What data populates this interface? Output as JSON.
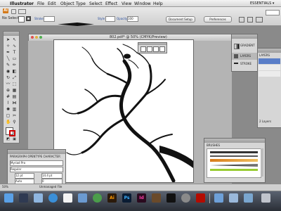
{
  "menubar": {
    "app_name": "Illustrator",
    "items": [
      "File",
      "Edit",
      "Object",
      "Type",
      "Select",
      "Effect",
      "View",
      "Window",
      "Help"
    ],
    "workspace_label": "ESSENTIALS ▾"
  },
  "control_bar": {
    "selection_label": "No Selection",
    "stroke_label": "Stroke",
    "style_label": "Style",
    "opacity_label": "Opacity",
    "opacity_value": "100",
    "document_setup_label": "Document Setup",
    "preferences_label": "Preferences"
  },
  "document": {
    "title": "802.pdf* @ 50% (CMYK/Preview)"
  },
  "panels": {
    "gradient_label": "GRADIENT",
    "layers_label": "LAYERS",
    "stroke_label": "STROKE",
    "layers_count": "2 Layers",
    "brushes_label": "BRUSHES",
    "character_tabs": "PARAGRAPH  OPENTYPE  CHARACTER",
    "font_family": "Myriad Pro",
    "font_style": "Regular",
    "font_size": "12 pt",
    "leading": "14.4 pt",
    "kerning": "Auto",
    "tracking": "0"
  },
  "status": {
    "zoom": "50%",
    "info": "Unmanaged File"
  },
  "dock": {
    "icons": [
      "finder-icon",
      "dashboard-icon",
      "mail-icon",
      "safari-icon",
      "ical-icon",
      "preview-icon",
      "itunes-icon",
      "illustrator-icon",
      "photoshop-icon",
      "indesign-icon",
      "bridge-icon",
      "terminal-icon",
      "system-prefs-icon",
      "acrobat-icon",
      "folder-icon",
      "documents-icon",
      "downloads-icon",
      "trash-icon"
    ]
  }
}
